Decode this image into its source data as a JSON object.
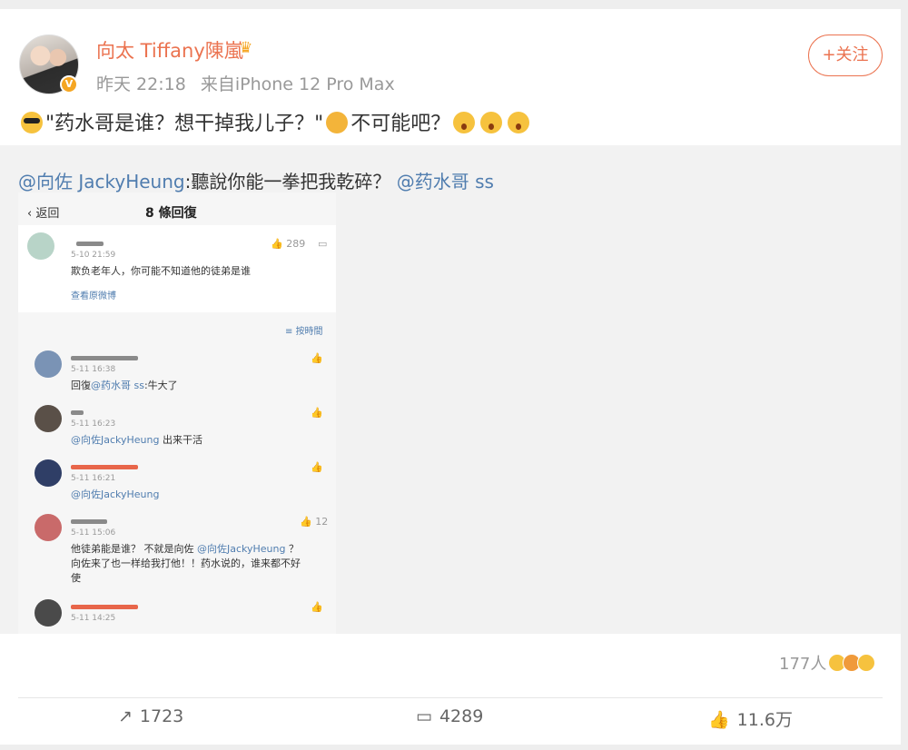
{
  "post": {
    "username": "向太 Tiffany陳嵐",
    "time": "昨天 22:18",
    "source": "来自iPhone 12 Pro Max",
    "follow_label": "+关注",
    "text_part1": "\"药水哥是谁？想干掉我儿子？\"",
    "text_part2": "不可能吧？",
    "crown_icon": "crown-icon",
    "accent_color": "#eb7350"
  },
  "quote": {
    "mention": "@向佐 JackyHeung",
    "text": ":聽說你能一拳把我乾碎？",
    "mention2": "@药水哥 ss"
  },
  "screenshot": {
    "back_label": "返回",
    "reply_count": "8 條回復",
    "top_comment": {
      "time": "5-10 21:59",
      "text": "欺负老年人，你可能不知道他的徒弟是谁",
      "likes": "289",
      "link": "查看原微博"
    },
    "sort_label": "按時間",
    "replies": [
      {
        "time": "5-11 16:38",
        "prefix": "回復",
        "mention": "@药水哥 ss",
        "text": ":牛大了",
        "likes": ""
      },
      {
        "time": "5-11 16:23",
        "prefix": "",
        "mention": "@向佐JackyHeung",
        "text": " 出来干活",
        "likes": ""
      },
      {
        "time": "5-11 16:21",
        "prefix": "",
        "mention": "@向佐JackyHeung",
        "text": "",
        "likes": ""
      },
      {
        "time": "5-11 15:06",
        "prefix": "他徒弟能是谁？ 不就是向佐 ",
        "mention": "@向佐JackyHeung",
        "text": " ？",
        "line2": "向佐来了也一样给我打他！！药水说的，谁来都不好",
        "line3": "使",
        "likes": "12"
      },
      {
        "time": "5-11 14:25",
        "prefix": "",
        "mention": "",
        "text": "",
        "likes": ""
      }
    ]
  },
  "stats": {
    "reactions_count": "177人",
    "repost": "1723",
    "comment": "4289",
    "like": "11.6万"
  }
}
